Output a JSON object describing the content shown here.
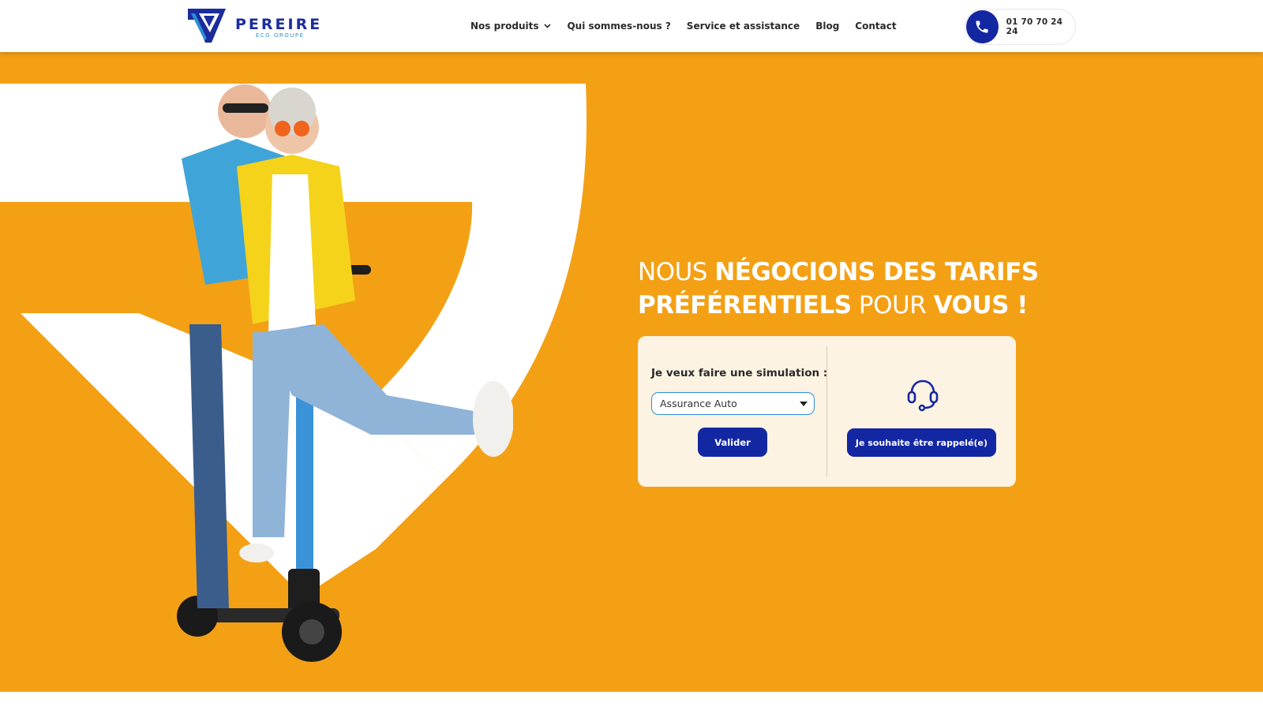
{
  "header": {
    "logo": {
      "name": "PEREIRE",
      "subtitle": "ECG GROUPE"
    },
    "nav": [
      {
        "label": "Nos produits",
        "has_dropdown": true
      },
      {
        "label": "Qui sommes-nous ?"
      },
      {
        "label": "Service et assistance"
      },
      {
        "label": "Blog"
      },
      {
        "label": "Contact"
      }
    ],
    "phone": {
      "number": "01 70 70 24 24",
      "icon": "phone-icon"
    }
  },
  "hero": {
    "headline": {
      "part1": "NOUS ",
      "part2": "NÉGOCIONS DES TARIFS PRÉFÉRENTIELS",
      "part3": " POUR ",
      "part4": "VOUS !"
    },
    "simulation": {
      "label": "Je veux faire une simulation :",
      "selected": "Assurance Auto",
      "submit_label": "Valider",
      "callback_label": "Je souhaite être rappelé(e)",
      "callback_icon": "headset-icon"
    }
  },
  "colors": {
    "brand_blue": "#1427a3",
    "accent_orange": "#f4a015",
    "card_bg": "#fcf3e3",
    "light_blue": "#2a8fd6"
  }
}
